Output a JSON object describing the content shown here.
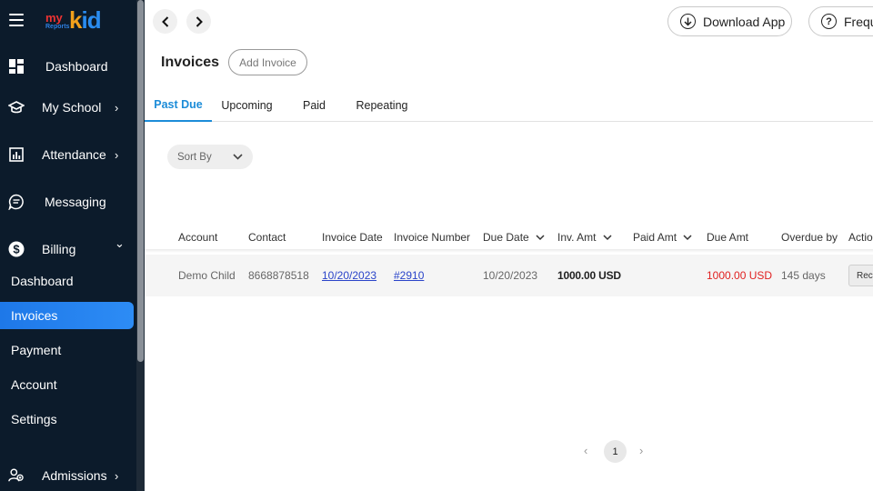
{
  "sidebar": {
    "logo": {
      "my": "my",
      "reports": "Reports",
      "kid": "id"
    },
    "items": [
      {
        "label": "Dashboard",
        "icon": "dashboard-icon"
      },
      {
        "label": "My School",
        "icon": "school-icon",
        "chevron": "›"
      },
      {
        "label": "Attendance",
        "icon": "attendance-icon",
        "chevron": "›"
      },
      {
        "label": "Messaging",
        "icon": "messaging-icon"
      },
      {
        "label": "Billing",
        "icon": "billing-icon",
        "chevron": "⌄"
      }
    ],
    "billing_sub": [
      "Dashboard",
      "Invoices",
      "Payment",
      "Account",
      "Settings"
    ],
    "admissions": {
      "label": "Admissions",
      "icon": "admissions-icon",
      "chevron": "›"
    }
  },
  "header": {
    "back": "‹",
    "forward": "›",
    "download_app": "Download App",
    "faq": "Frequ"
  },
  "page": {
    "title": "Invoices",
    "add_invoice": "Add Invoice"
  },
  "tabs": [
    "Past Due",
    "Upcoming",
    "Paid",
    "Repeating"
  ],
  "sort_by": "Sort By",
  "table": {
    "headers": [
      "Account",
      "Contact",
      "Invoice Date",
      "Invoice Number",
      "Due Date",
      "Inv. Amt",
      "Paid Amt",
      "Due Amt",
      "Overdue by",
      "Actio"
    ],
    "rows": [
      {
        "account": "Demo Child",
        "contact": "8668878518",
        "invoice_date": "10/20/2023",
        "invoice_number": "#2910",
        "due_date": "10/20/2023",
        "inv_amt": "1000.00 USD",
        "paid_amt": "",
        "due_amt": "1000.00 USD",
        "overdue_by": "145 days",
        "action": "Rec"
      }
    ]
  },
  "pagination": {
    "current": "1",
    "prev": "‹",
    "next": "›"
  },
  "colors": {
    "sidebar_bg": "#0c1b2b",
    "accent": "#1c8cd8",
    "active_item": "#1e78e8",
    "due_red": "#e02020",
    "link": "#2a44c9"
  }
}
